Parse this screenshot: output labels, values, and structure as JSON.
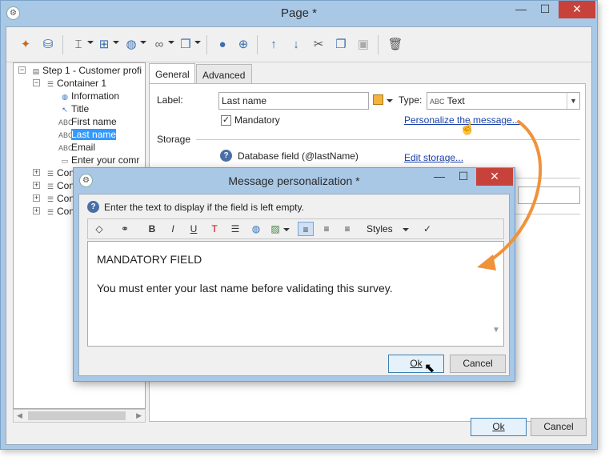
{
  "window": {
    "title": "Page  *",
    "minimize": "—",
    "maximize": "☐",
    "close": "✕"
  },
  "toolbar_icons": [
    "wand-icon",
    "database-icon",
    "text-cursor-icon",
    "field-icon",
    "globe-icon",
    "link-icon",
    "package-icon",
    "user-icon",
    "add-user-icon",
    "arrow-up-icon",
    "arrow-down-icon",
    "cut-icon",
    "copy-icon",
    "paste-icon",
    "trash-icon"
  ],
  "tree": {
    "items": [
      {
        "label": "Step 1 - Customer profi",
        "level": 0
      },
      {
        "label": "Container 1",
        "level": 1
      },
      {
        "label": "Information",
        "level": 2
      },
      {
        "label": "Title",
        "level": 2
      },
      {
        "label": "First name",
        "level": 2
      },
      {
        "label": "Last name",
        "level": 2
      },
      {
        "label": "Email",
        "level": 2
      },
      {
        "label": "Enter your comr",
        "level": 2
      },
      {
        "label": "Container 2",
        "level": 1
      },
      {
        "label": "Cont",
        "level": 1
      },
      {
        "label": "Cont",
        "level": 1
      },
      {
        "label": "Cont",
        "level": 1
      }
    ]
  },
  "tabs": {
    "general": "General",
    "advanced": "Advanced"
  },
  "form": {
    "label_caption": "Label:",
    "label_value": "Last name",
    "type_caption": "Type:",
    "type_prefix": "ABC",
    "type_value": "Text",
    "mandatory": "Mandatory",
    "personalize_link": "Personalize the message...",
    "storage_heading": "Storage",
    "db_field": "Database field (@lastName)",
    "edit_storage": "Edit storage...",
    "help": "?"
  },
  "buttons": {
    "ok": "Ok",
    "cancel": "Cancel"
  },
  "dialog": {
    "title": "Message personalization *",
    "hint": "Enter the text to display if the field is left empty.",
    "styles": "Styles",
    "line1": "MANDATORY FIELD",
    "line2": "You must enter your last name before validating this survey.",
    "ok": "Ok",
    "cancel": "Cancel"
  },
  "colors": {
    "titlebar": "#a9c8e6",
    "accent_arrow": "#f0923a",
    "selection": "#3399ff",
    "link": "#1a3fa8"
  }
}
